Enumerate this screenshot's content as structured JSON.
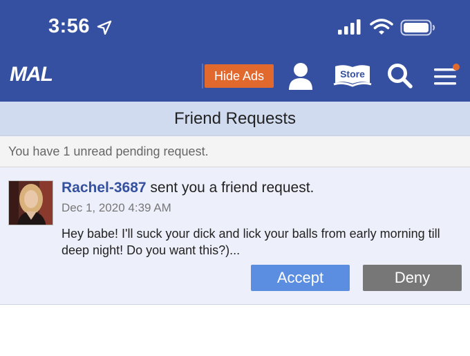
{
  "status_bar": {
    "time": "3:56",
    "icons": [
      "location-arrow-icon",
      "signal-icon",
      "wifi-icon",
      "battery-icon"
    ]
  },
  "header": {
    "logo": "MAL",
    "hide_ads_label": "Hide Ads",
    "store_label": "Store",
    "icons": [
      "user-icon",
      "store-icon",
      "search-icon",
      "menu-icon"
    ],
    "colors": {
      "header_bg": "#3550a0",
      "hide_ads_bg": "#e2692e",
      "notification_dot": "#e2692e"
    }
  },
  "page": {
    "title": "Friend Requests",
    "notice": "You have 1 unread pending request."
  },
  "request": {
    "username": "Rachel-3687",
    "action_text": " sent you a friend request.",
    "date": "Dec 1, 2020 4:39 AM",
    "message": "Hey babe! I'll suck your dick and lick your balls from early morning till deep night! Do you want this?)...",
    "accept_label": "Accept",
    "deny_label": "Deny",
    "colors": {
      "username": "#3451a0",
      "accept_bg": "#5b8ee0",
      "deny_bg": "#777777",
      "card_bg": "#edeffa"
    }
  }
}
